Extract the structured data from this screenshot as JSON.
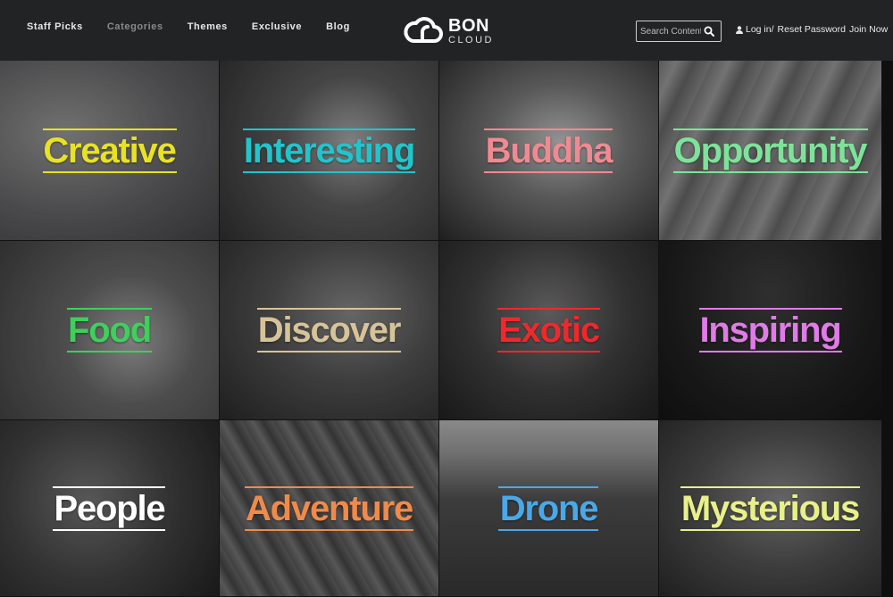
{
  "nav": {
    "items": [
      {
        "label": "Staff Picks",
        "muted": false
      },
      {
        "label": "Categories",
        "muted": true
      },
      {
        "label": "Themes",
        "muted": false
      },
      {
        "label": "Exclusive",
        "muted": false
      },
      {
        "label": "Blog",
        "muted": false
      }
    ]
  },
  "logo": {
    "line1": "BON",
    "line2": "CLOUD"
  },
  "search": {
    "placeholder": "Search Contents"
  },
  "account": {
    "login": "Log in/",
    "reset": "Reset Password",
    "join": "Join Now"
  },
  "tiles": [
    {
      "label": "Creative",
      "color": "#e8e224",
      "bg": "creative"
    },
    {
      "label": "Interesting",
      "color": "#22c4cc",
      "bg": "interesting"
    },
    {
      "label": "Buddha",
      "color": "#f08a92",
      "bg": "buddha"
    },
    {
      "label": "Opportunity",
      "color": "#7ee39a",
      "bg": "opportunity"
    },
    {
      "label": "Food",
      "color": "#3fcf5c",
      "bg": "food"
    },
    {
      "label": "Discover",
      "color": "#d7c39a",
      "bg": "discover"
    },
    {
      "label": "Exotic",
      "color": "#f0282c",
      "bg": "exotic"
    },
    {
      "label": "Inspiring",
      "color": "#e07be8",
      "bg": "inspiring"
    },
    {
      "label": "People",
      "color": "#ffffff",
      "bg": "people"
    },
    {
      "label": "Adventure",
      "color": "#f08a4a",
      "bg": "adventure"
    },
    {
      "label": "Drone",
      "color": "#4aa8e8",
      "bg": "drone"
    },
    {
      "label": "Mysterious",
      "color": "#e8f08a",
      "bg": "mysterious"
    }
  ]
}
